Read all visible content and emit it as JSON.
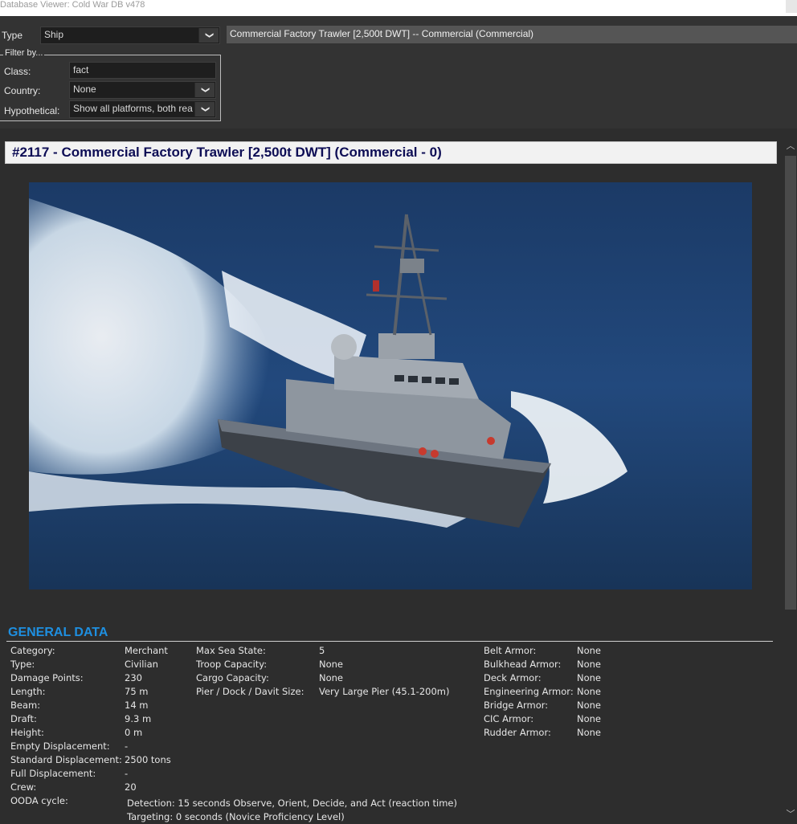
{
  "window": {
    "title": "Database Viewer: Cold War DB v478"
  },
  "toolbar": {
    "type_label": "Type",
    "type_value": "Ship",
    "selected_item": "Commercial Factory Trawler [2,500t DWT] -- Commercial (Commercial)",
    "filter_legend": "Filter by...",
    "class_label": "Class:",
    "class_value": "fact",
    "country_label": "Country:",
    "country_value": "None",
    "hypothetical_label": "Hypothetical:",
    "hypothetical_value": "Show all platforms, both rea",
    "dropdown_glyph": "❯"
  },
  "record": {
    "title": "#2117 - Commercial Factory Trawler [2,500t DWT] (Commercial - 0)",
    "image": "patrol-ship-photo"
  },
  "general": {
    "title": "GENERAL DATA",
    "col1": [
      {
        "label": "Category:",
        "value": "Merchant"
      },
      {
        "label": "Type:",
        "value": "Civilian"
      },
      {
        "label": "Damage Points:",
        "value": "230"
      },
      {
        "label": "Length:",
        "value": "75 m"
      },
      {
        "label": "Beam:",
        "value": "14 m"
      },
      {
        "label": "Draft:",
        "value": "9.3 m"
      },
      {
        "label": "Height:",
        "value": "0 m"
      },
      {
        "label": "Empty Displacement:",
        "value": "-"
      },
      {
        "label": "Standard Displacement:",
        "value": "2500 tons"
      },
      {
        "label": "Full Displacement:",
        "value": "-"
      },
      {
        "label": "Crew:",
        "value": "20"
      },
      {
        "label": "OODA cycle:",
        "value": ""
      }
    ],
    "col2": [
      {
        "label": "Max Sea State:",
        "value": "5"
      },
      {
        "label": "Troop Capacity:",
        "value": "None"
      },
      {
        "label": "Cargo Capacity:",
        "value": "None"
      },
      {
        "label": "Pier / Dock / Davit Size:",
        "value": "Very Large Pier (45.1-200m)"
      }
    ],
    "col3": [
      {
        "label": "Belt Armor:",
        "value": "None"
      },
      {
        "label": "Bulkhead Armor:",
        "value": "None"
      },
      {
        "label": "Deck Armor:",
        "value": "None"
      },
      {
        "label": "Engineering Armor:",
        "value": "None"
      },
      {
        "label": "Bridge Armor:",
        "value": "None"
      },
      {
        "label": "CIC Armor:",
        "value": "None"
      },
      {
        "label": "Rudder Armor:",
        "value": "None"
      }
    ],
    "ooda_detection": "Detection: 15 seconds Observe, Orient, Decide, and Act (reaction time)",
    "ooda_targeting": "Targeting: 0 seconds (Novice Proficiency Level)"
  },
  "colors": {
    "accent": "#1e8fe0",
    "header_text": "#0d0d55",
    "background": "#2d2d2d"
  }
}
